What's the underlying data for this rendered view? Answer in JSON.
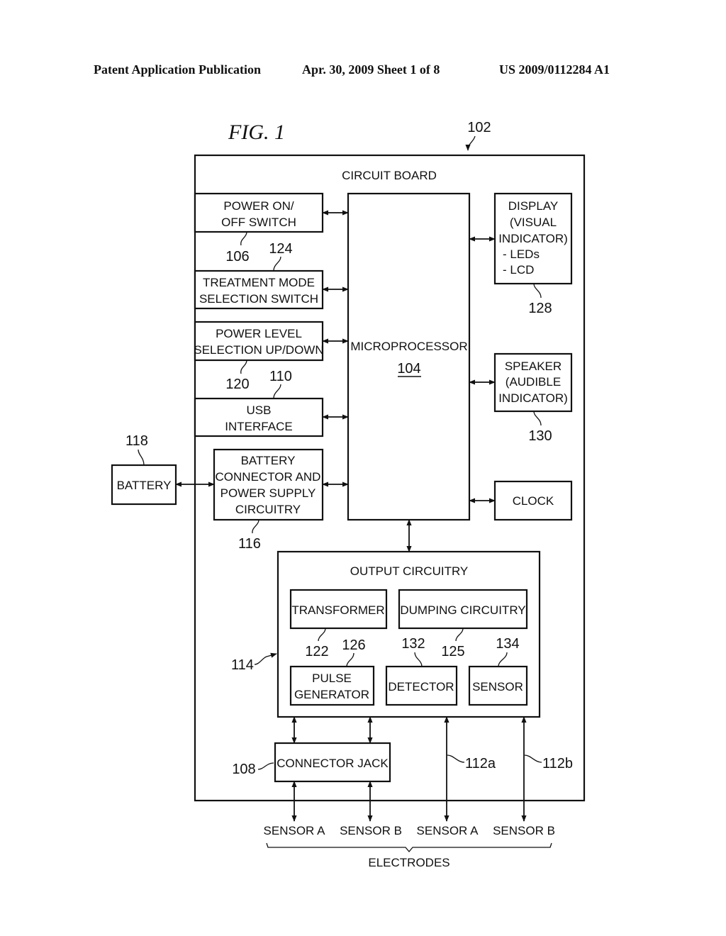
{
  "header": {
    "publication": "Patent Application Publication",
    "date_sheet": "Apr. 30, 2009  Sheet 1 of 8",
    "number": "US 2009/0112284 A1"
  },
  "figure": {
    "title": "FIG. 1",
    "board": {
      "label": "CIRCUIT BOARD",
      "ref": "102"
    },
    "blocks": {
      "power_switch": {
        "lines": [
          "POWER ON/",
          "OFF SWITCH"
        ],
        "ref": "106"
      },
      "treatment_mode": {
        "lines": [
          "TREATMENT MODE",
          "SELECTION SWITCH"
        ],
        "ref": "124"
      },
      "power_level": {
        "lines": [
          "POWER LEVEL",
          "SELECTION UP/DOWN"
        ],
        "ref": "120"
      },
      "usb": {
        "lines": [
          "USB",
          "INTERFACE"
        ],
        "ref": "110"
      },
      "battery_connector": {
        "lines": [
          "BATTERY",
          "CONNECTOR AND",
          "POWER SUPPLY",
          "CIRCUITRY"
        ],
        "ref": "116"
      },
      "battery": {
        "lines": [
          "BATTERY"
        ],
        "ref": "118"
      },
      "microprocessor": {
        "lines": [
          "MICROPROCESSOR"
        ],
        "ref": "104"
      },
      "display": {
        "lines": [
          "DISPLAY",
          "(VISUAL",
          "INDICATOR)",
          "- LEDs",
          "- LCD"
        ],
        "ref": "128"
      },
      "speaker": {
        "lines": [
          "SPEAKER",
          "(AUDIBLE",
          "INDICATOR)"
        ],
        "ref": "130"
      },
      "clock": {
        "lines": [
          "CLOCK"
        ]
      },
      "output_circuitry": {
        "label": "OUTPUT CIRCUITRY",
        "ref": "114"
      },
      "transformer": {
        "lines": [
          "TRANSFORMER"
        ],
        "ref": "122"
      },
      "dumping": {
        "lines": [
          "DUMPING CIRCUITRY"
        ],
        "ref": "125"
      },
      "pulse_generator": {
        "lines": [
          "PULSE",
          "GENERATOR"
        ],
        "ref": "126"
      },
      "detector": {
        "lines": [
          "DETECTOR"
        ],
        "ref": "132"
      },
      "sensor": {
        "lines": [
          "SENSOR"
        ],
        "ref": "134"
      },
      "connector_jack": {
        "lines": [
          "CONNECTOR JACK"
        ],
        "ref": "108"
      }
    },
    "leads": {
      "a_ref": "112a",
      "b_ref": "112b"
    },
    "electrodes": {
      "labels": [
        "SENSOR A",
        "SENSOR B",
        "SENSOR A",
        "SENSOR B"
      ],
      "group_label": "ELECTRODES"
    }
  }
}
